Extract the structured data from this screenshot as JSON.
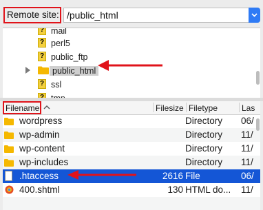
{
  "remote_site": {
    "label": "Remote site:",
    "path": "/public_html"
  },
  "tree": {
    "items": [
      {
        "label": "mail",
        "icon": "unknown-folder-icon"
      },
      {
        "label": "perl5",
        "icon": "unknown-folder-icon"
      },
      {
        "label": "public_ftp",
        "icon": "unknown-folder-icon"
      },
      {
        "label": "public_html",
        "icon": "folder-icon",
        "selected": true,
        "expandable": true
      },
      {
        "label": "ssl",
        "icon": "unknown-folder-icon"
      },
      {
        "label": "tmp",
        "icon": "unknown-folder-icon"
      }
    ]
  },
  "file_list": {
    "headers": {
      "filename": "Filename",
      "filesize": "Filesize",
      "filetype": "Filetype",
      "last": "Las"
    },
    "rows": [
      {
        "name": "wordpress",
        "size": "",
        "type": "Directory",
        "last": "06/",
        "icon": "folder"
      },
      {
        "name": "wp-admin",
        "size": "",
        "type": "Directory",
        "last": "11/",
        "icon": "folder"
      },
      {
        "name": "wp-content",
        "size": "",
        "type": "Directory",
        "last": "11/",
        "icon": "folder"
      },
      {
        "name": "wp-includes",
        "size": "",
        "type": "Directory",
        "last": "11/",
        "icon": "folder"
      },
      {
        "name": ".htaccess",
        "size": "2616",
        "type": "File",
        "last": "06/",
        "icon": "file",
        "selected": true
      },
      {
        "name": "400.shtml",
        "size": "130",
        "type": "HTML do...",
        "last": "11/",
        "icon": "globe"
      }
    ]
  },
  "colors": {
    "highlight_red": "#e0131a",
    "selection_blue": "#1456d6",
    "folder_yellow": "#f5b800"
  }
}
